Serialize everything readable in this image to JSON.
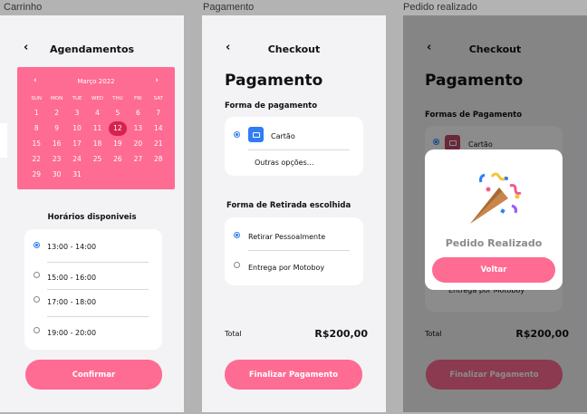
{
  "frames": {
    "carrinho_label": "Carrinho",
    "pagamento_label": "Pagamento",
    "pedido_label": "Pedido realizado"
  },
  "schedule": {
    "back": "‹",
    "title": "Agendamentos",
    "calendar": {
      "month": "Março 2022",
      "prev": "‹",
      "next": "›",
      "weekdays": [
        "SUN",
        "MON",
        "TUE",
        "WED",
        "THU",
        "FRI",
        "SAT"
      ],
      "days": [
        "1",
        "2",
        "3",
        "4",
        "5",
        "6",
        "7",
        "8",
        "9",
        "10",
        "11",
        "12",
        "13",
        "14",
        "15",
        "16",
        "17",
        "18",
        "19",
        "20",
        "21",
        "22",
        "23",
        "24",
        "25",
        "26",
        "27",
        "28",
        "29",
        "30",
        "31"
      ],
      "selected_day": "12"
    },
    "slots_title": "Horários disponiveis",
    "slots": [
      "13:00 - 14:00",
      "15:00 - 16:00",
      "17:00 - 18:00",
      "19:00 - 20:00"
    ],
    "confirm": "Confirmar"
  },
  "checkout": {
    "back": "‹",
    "title": "Checkout",
    "heading": "Pagamento",
    "payment_title": "Forma de pagamento",
    "card_label": "Cartão",
    "other_options": "Outras opções...",
    "pickup_title": "Forma de Retirada escolhida",
    "pickup_options": [
      "Retirar Pessoalmente",
      "Entrega por Motoboy"
    ],
    "total_label": "Total",
    "total_value": "R$200,00",
    "finish": "Finalizar Pagamento"
  },
  "done": {
    "back": "‹",
    "title": "Checkout",
    "heading": "Pagamento",
    "payment_title": "Formas de Pagamento",
    "card_label": "Cartão",
    "pickup_option": "Entrega por Motoboy",
    "total_label": "Total",
    "total_value": "R$200,00",
    "finish": "Finalizar Pagamento",
    "modal_title": "Pedido Realizado",
    "modal_button": "Voltar"
  },
  "colors": {
    "accent": "#fe6b93",
    "selected_day": "#d6224f",
    "radio": "#2f7df6"
  }
}
